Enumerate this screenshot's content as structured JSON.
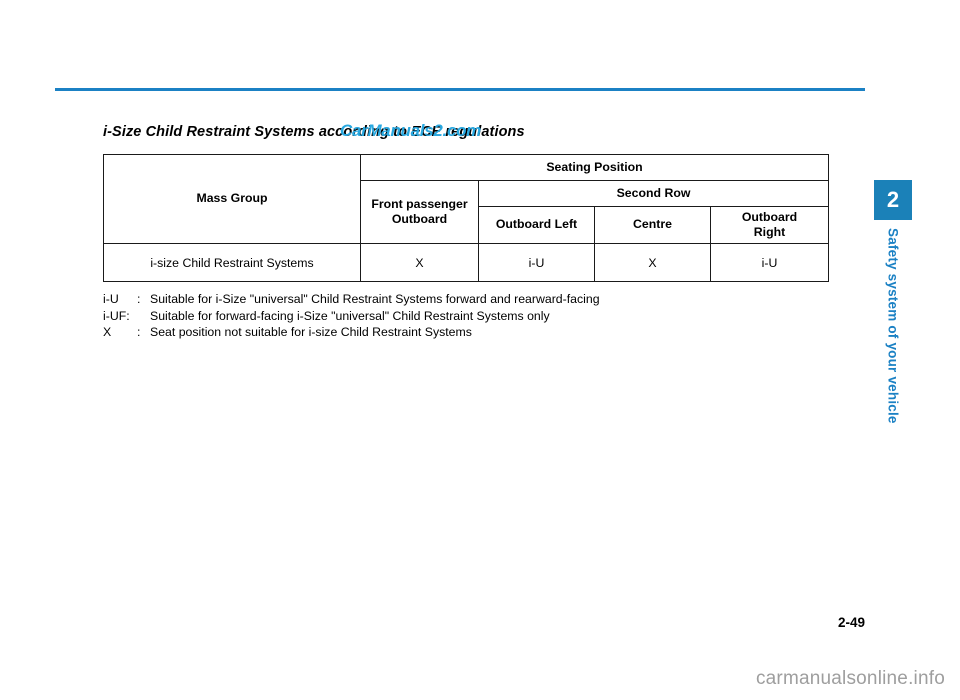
{
  "document": {
    "section_heading": "i-Size Child Restraint Systems according to ECE regulations",
    "page_number": "2-49"
  },
  "watermarks": {
    "inline": "CarManuals2.com",
    "inline_color": "#29a8e0",
    "footer": "carmanualsonline.info",
    "footer_color": "#9e9e9e"
  },
  "chapter_tab": {
    "number": "2",
    "title": "Safety system of your vehicle",
    "box_color": "#1b81b8",
    "title_color": "#1b81c4"
  },
  "rule": {
    "color": "#1b81c4"
  },
  "table": {
    "headers": {
      "mass_group": "Mass Group",
      "seating_position": "Seating Position",
      "front_passenger_outboard_line1": "Front passenger",
      "front_passenger_outboard_line2": "Outboard",
      "second_row": "Second Row",
      "outboard_left": "Outboard Left",
      "centre": "Centre",
      "outboard_right_line1": "Outboard",
      "outboard_right_line2": "Right"
    },
    "rows": [
      {
        "label": "i-size Child Restraint Systems",
        "front_passenger_outboard": "X",
        "second_row_outboard_left": "i-U",
        "second_row_centre": "X",
        "second_row_outboard_right": "i-U"
      }
    ]
  },
  "legend": [
    {
      "key": "i-U",
      "sep": ":",
      "desc": "Suitable for i-Size \"universal\" Child Restraint Systems forward and rearward-facing"
    },
    {
      "key": "i-UF:",
      "sep": "",
      "desc": "Suitable for forward-facing i-Size \"universal\" Child Restraint Systems only"
    },
    {
      "key": "X",
      "sep": ":",
      "desc": "Seat position not suitable for i-size Child Restraint Systems"
    }
  ]
}
